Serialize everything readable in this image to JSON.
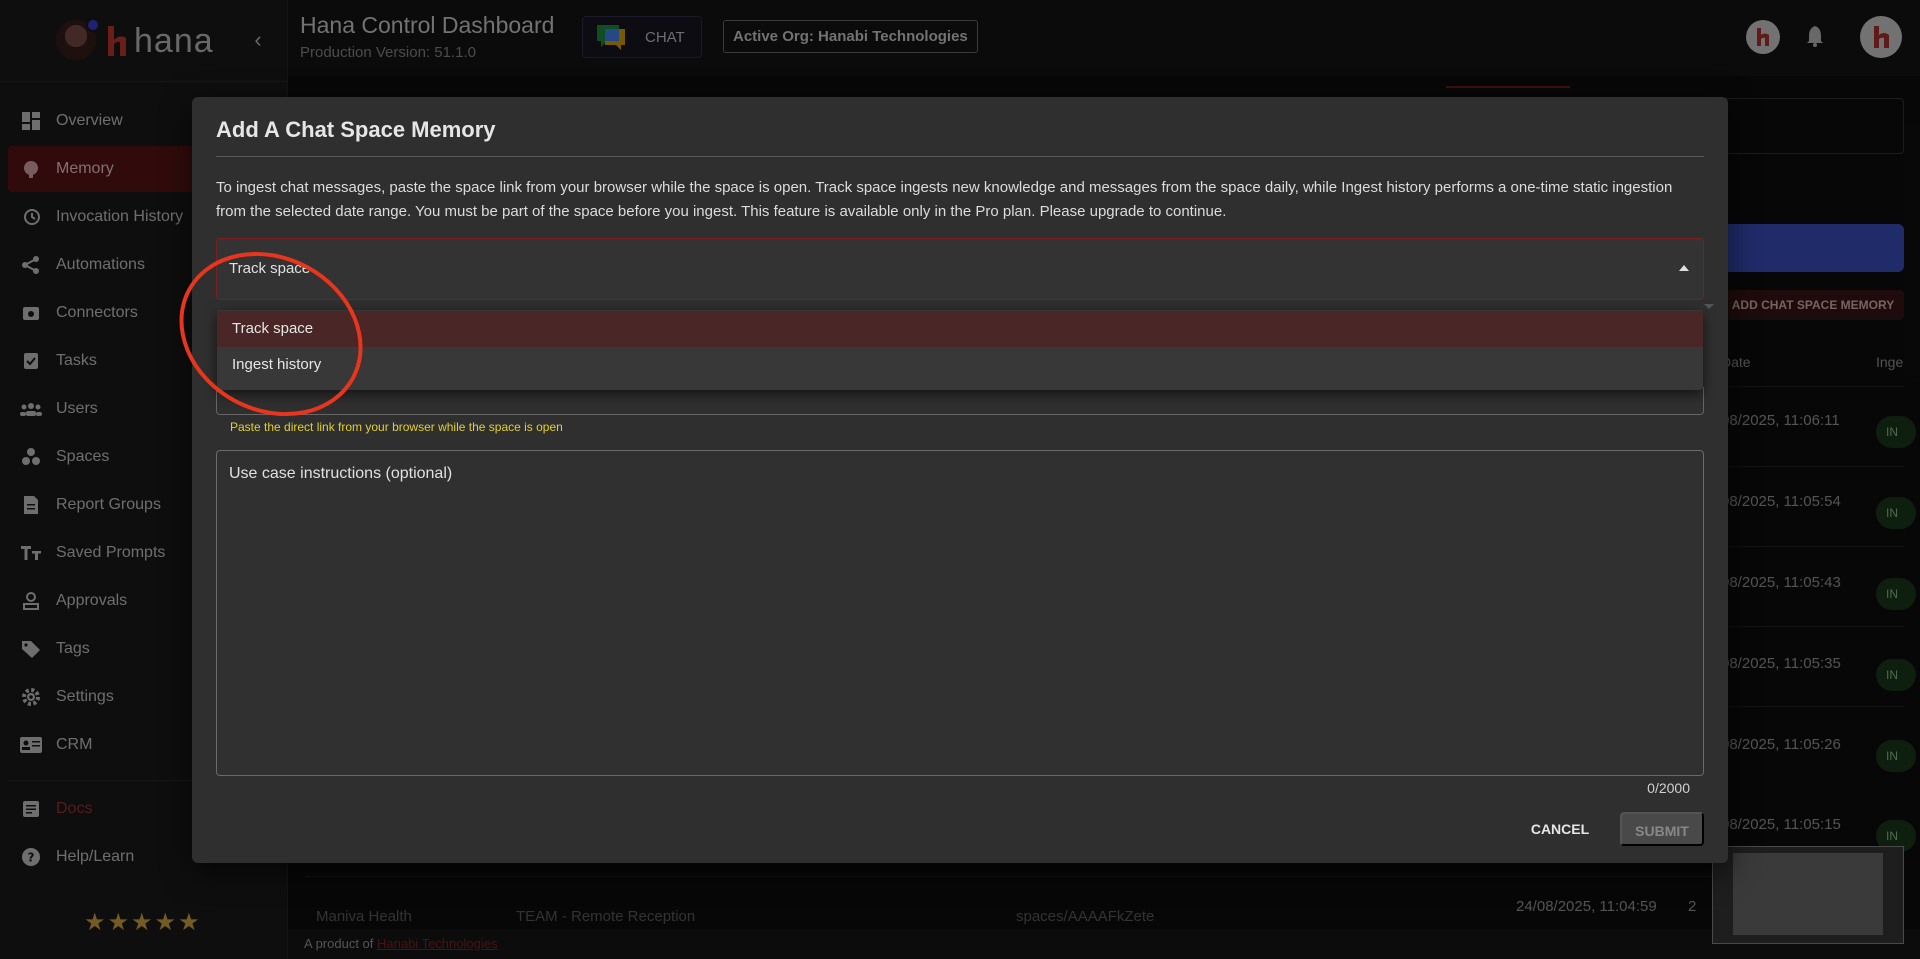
{
  "sidebar": {
    "logo_text": "hana",
    "items": [
      {
        "label": "Overview",
        "icon": "dashboard-icon",
        "active": false
      },
      {
        "label": "Memory",
        "icon": "brain-icon",
        "active": true
      },
      {
        "label": "Invocation History",
        "icon": "history-icon",
        "active": false
      },
      {
        "label": "Automations",
        "icon": "share-icon",
        "active": false
      },
      {
        "label": "Connectors",
        "icon": "connector-icon",
        "active": false
      },
      {
        "label": "Tasks",
        "icon": "task-icon",
        "active": false
      },
      {
        "label": "Users",
        "icon": "users-icon",
        "active": false
      },
      {
        "label": "Spaces",
        "icon": "spaces-icon",
        "active": false
      },
      {
        "label": "Report Groups",
        "icon": "report-icon",
        "active": false
      },
      {
        "label": "Saved Prompts",
        "icon": "text-icon",
        "active": false
      },
      {
        "label": "Approvals",
        "icon": "approval-icon",
        "active": false
      },
      {
        "label": "Tags",
        "icon": "tag-icon",
        "active": false
      },
      {
        "label": "Settings",
        "icon": "gear-icon",
        "active": false
      },
      {
        "label": "CRM",
        "icon": "crm-icon",
        "active": false
      }
    ],
    "secondary": [
      {
        "label": "Docs",
        "icon": "document-icon"
      },
      {
        "label": "Help/Learn",
        "icon": "help-icon"
      }
    ],
    "rating": "★★★★★"
  },
  "header": {
    "title": "Hana Control Dashboard",
    "version": "Production Version: 51.1.0",
    "chat_label": "CHAT",
    "org_label": "Active Org: Hanabi Technologies"
  },
  "background": {
    "add_button": "ADD CHAT SPACE MEMORY",
    "col_date": "Date",
    "col_inge": "Inge",
    "rows": [
      {
        "date": "08/2025, 11:06:11",
        "status": "IN"
      },
      {
        "date": "08/2025, 11:05:54",
        "status": "IN"
      },
      {
        "date": "08/2025, 11:05:43",
        "status": "IN"
      },
      {
        "date": "08/2025, 11:05:35",
        "status": "IN"
      },
      {
        "date": "08/2025, 11:05:26",
        "status": "IN"
      },
      {
        "date": "08/2025, 11:05:15",
        "status": "IN"
      }
    ],
    "last_row": {
      "name": "Maniva Health",
      "team": "TEAM - Remote Reception",
      "space": "spaces/AAAAFkZete",
      "date": "24/08/2025, 11:04:59",
      "num": "2"
    }
  },
  "footer": {
    "prefix": "A product of ",
    "link": "Hanabi Technologies"
  },
  "modal": {
    "title": "Add A Chat Space Memory",
    "description": "To ingest chat messages, paste the space link from your browser while the space is open. Track space ingests new knowledge and messages from the space daily, while Ingest history performs a one-time static ingestion from the selected date range. You must be part of the space before you ingest. This feature is available only in the Pro plan. Please upgrade to continue.",
    "mode_value": "Track space",
    "link_helper": "Paste the direct link from your browser while the space is open",
    "instructions_label": "Use case instructions (optional)",
    "char_count": "0/2000",
    "cancel": "CANCEL",
    "submit": "SUBMIT"
  },
  "menu": {
    "options": [
      "Track space",
      "Ingest history"
    ],
    "selected": "Track space"
  },
  "colors": {
    "accent_red": "#5a1414",
    "annotation": "#e8351e",
    "helper_yellow": "#e0d030"
  }
}
